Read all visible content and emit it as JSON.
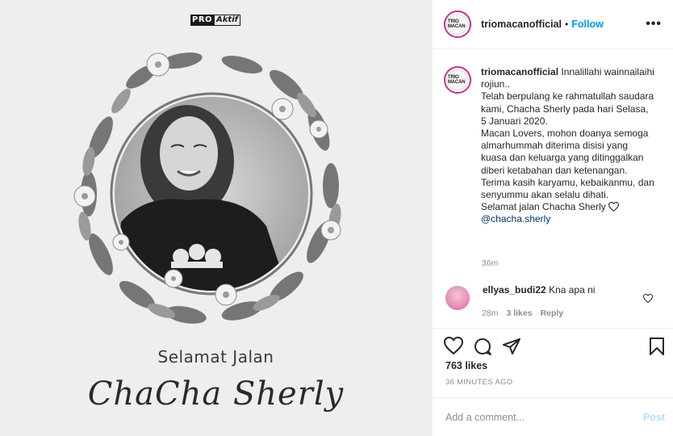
{
  "post": {
    "brand_logo": {
      "part1": "PRO",
      "part2": "Aktif"
    },
    "title_line": "Selamat Jalan",
    "name_script": "ChaCha Sherly"
  },
  "header": {
    "username": "triomacanofficial",
    "separator": "•",
    "follow_label": "Follow",
    "more_label": "•••",
    "avatar_label": "TRIO MACAN"
  },
  "caption": {
    "username": "triomacanofficial",
    "lines": [
      "Innalillahi wainnailaihi rojiun..",
      "Telah berpulang ke rahmatullah saudara kami, Chacha Sherly pada hari Selasa, 5 Januari 2020.",
      "Macan Lovers, mohon doanya semoga almarhummah diterima disisi yang kuasa dan keluarga yang ditinggalkan diberi ketabahan dan ketenangan. Terima kasih karyamu, kebaikanmu, dan senyummu akan selalu dihati.",
      "Selamat jalan Chacha Sherly"
    ],
    "mention": "@chacha.sherly",
    "time": "36m"
  },
  "comment": {
    "username": "ellyas_budi22",
    "text": "Kna apa ni",
    "time": "28m",
    "likes": "3 likes",
    "reply_label": "Reply"
  },
  "actions": {
    "likes_count": "763 likes",
    "time_ago": "36 MINUTES AGO"
  },
  "add_comment": {
    "placeholder": "Add a comment...",
    "post_label": "Post"
  },
  "colors": {
    "link_blue": "#0095f6",
    "post_disabled": "#b2dffc",
    "muted": "#8e8e8e",
    "text": "#262626",
    "story_ring": "#c1358b"
  }
}
